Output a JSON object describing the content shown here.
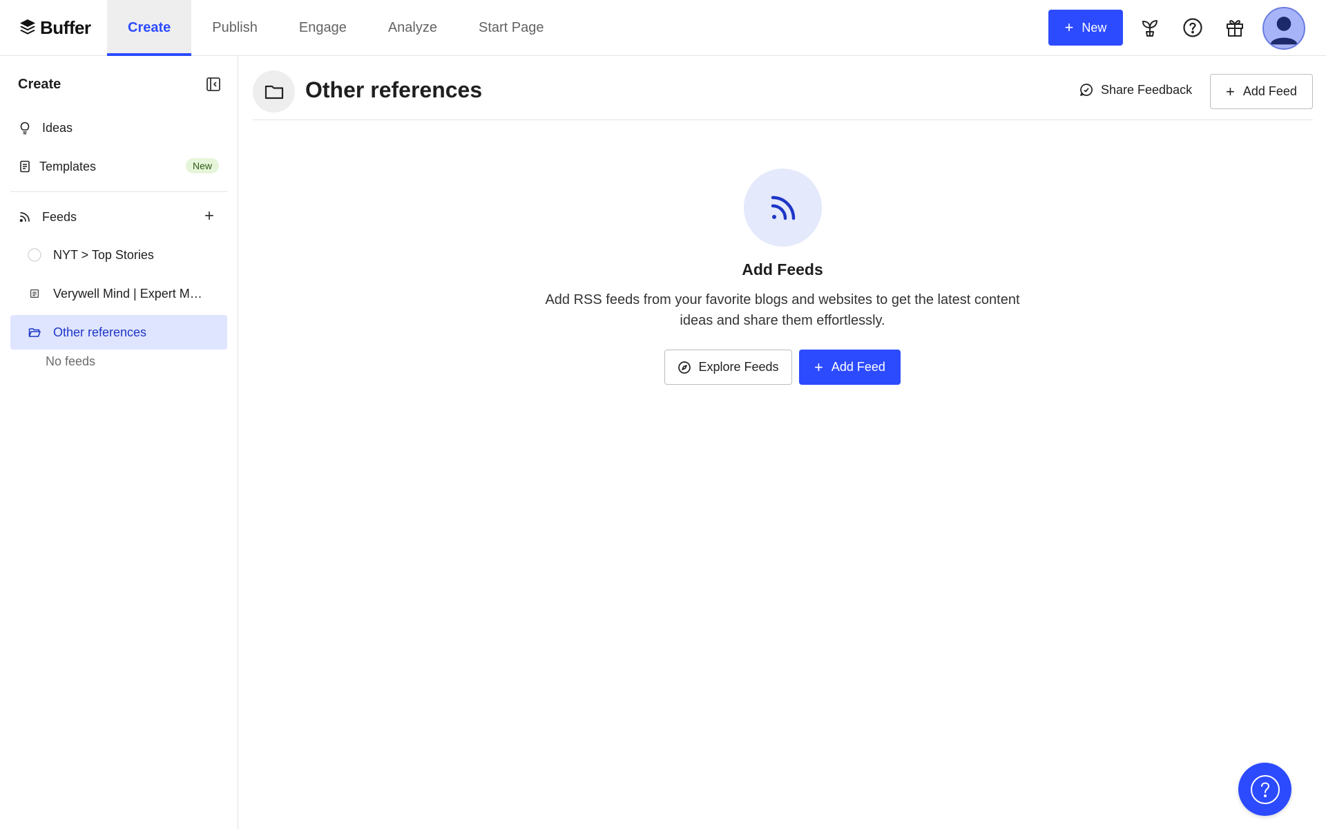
{
  "brand": {
    "name": "Buffer"
  },
  "nav": {
    "tabs": [
      {
        "label": "Create"
      },
      {
        "label": "Publish"
      },
      {
        "label": "Engage"
      },
      {
        "label": "Analyze"
      },
      {
        "label": "Start Page"
      }
    ]
  },
  "topbar": {
    "new_label": "New"
  },
  "sidebar": {
    "title": "Create",
    "ideas_label": "Ideas",
    "templates_label": "Templates",
    "templates_badge": "New",
    "feeds_label": "Feeds",
    "feed_items": [
      {
        "label": "NYT > Top Stories"
      },
      {
        "label": "Verywell Mind | Expert M…"
      },
      {
        "label": "Other references"
      }
    ],
    "no_feeds_label": "No feeds"
  },
  "main": {
    "title": "Other references",
    "share_feedback_label": "Share Feedback",
    "add_feed_label": "Add Feed",
    "empty_title": "Add Feeds",
    "empty_description": "Add RSS feeds from your favorite blogs and websites to get the latest content ideas and share them effortlessly.",
    "explore_label": "Explore Feeds",
    "add_feed_primary_label": "Add Feed"
  },
  "colors": {
    "accent": "#2c4bff",
    "selected_bg": "#dfe5ff",
    "badge_bg": "#e6f5d9"
  },
  "icons": [
    "buffer-logo-icon",
    "plant-icon",
    "help-icon",
    "gift-icon",
    "avatar-icon",
    "collapse-icon",
    "bulb-icon",
    "template-icon",
    "rss-icon",
    "plus-icon",
    "folder-icon",
    "feedback-icon",
    "compass-icon"
  ]
}
